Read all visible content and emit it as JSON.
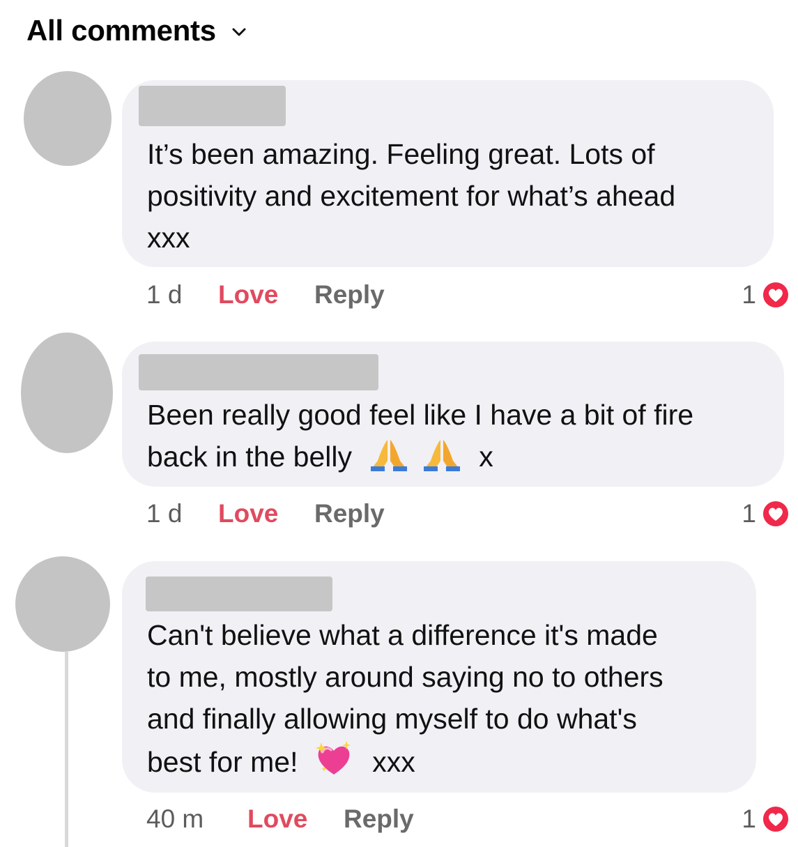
{
  "header": {
    "title": "All comments",
    "chevron_icon": "chevron-down-icon"
  },
  "comments": [
    {
      "text_lines": [
        "It’s been amazing. Feeling great. Lots of",
        "positivity and excitement for what’s ahead",
        "xxx"
      ],
      "time": "1 d",
      "love_label": "Love",
      "reply_label": "Reply",
      "reaction_count": "1",
      "reaction_icon": "love-reaction-icon"
    },
    {
      "text_lines": [
        "Been really good feel like I have a bit of fire",
        "back in the belly"
      ],
      "text_tail": "x",
      "emojis": [
        "folded-hands-emoji",
        "folded-hands-emoji"
      ],
      "time": "1 d",
      "love_label": "Love",
      "reply_label": "Reply",
      "reaction_count": "1",
      "reaction_icon": "love-reaction-icon"
    },
    {
      "text_lines": [
        "Can't believe what a difference it's made",
        "to me, mostly around saying no to others",
        "and finally allowing myself to do what's",
        "best for me!"
      ],
      "text_tail": "xxx",
      "emojis": [
        "sparkling-heart-emoji"
      ],
      "time": "40 m",
      "love_label": "Love",
      "reply_label": "Reply",
      "reaction_count": "1",
      "reaction_icon": "love-reaction-icon"
    }
  ],
  "colors": {
    "love": "#e04a5f",
    "bubble": "#f0f0f5",
    "avatar": "#c4c4c4",
    "reaction": "#f0284a"
  }
}
